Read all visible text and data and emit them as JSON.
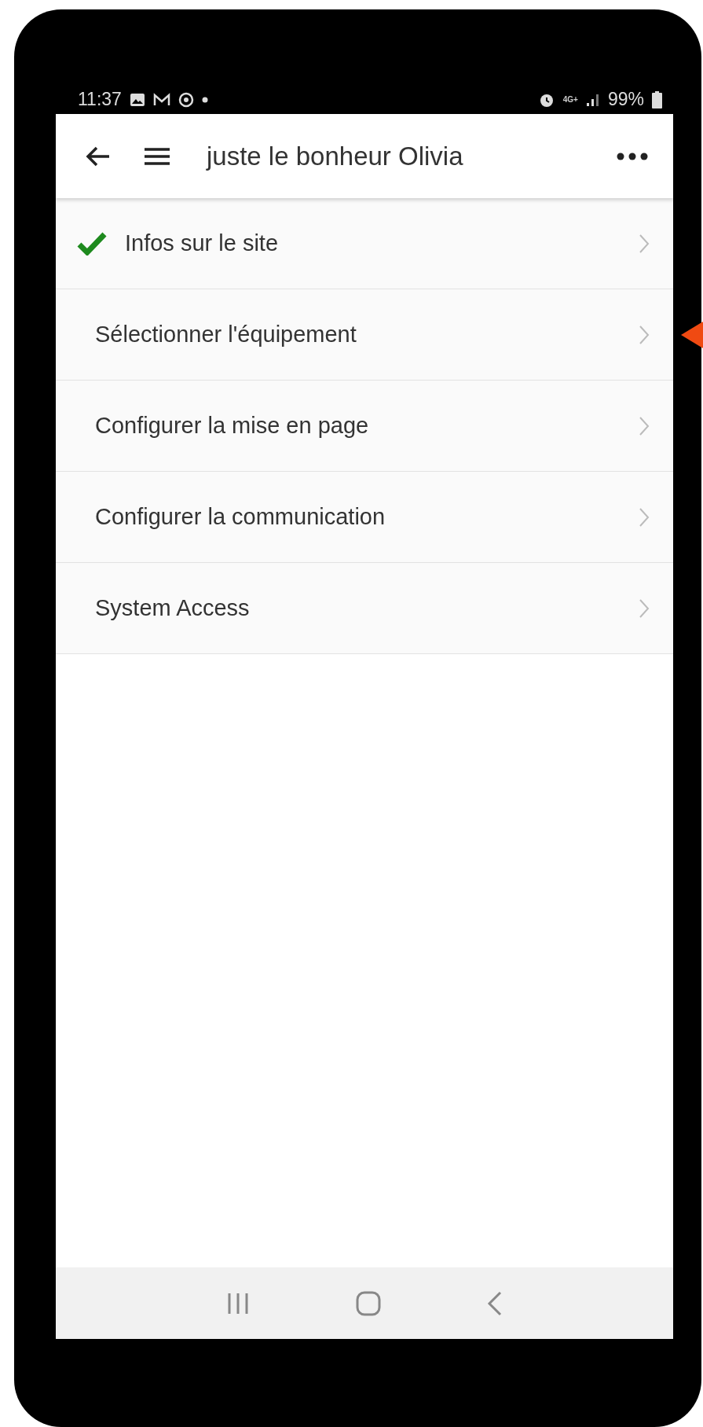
{
  "status_bar": {
    "time": "11:37",
    "network": "4G+",
    "battery": "99%"
  },
  "app_bar": {
    "title": "juste le bonheur Olivia"
  },
  "menu_items": [
    {
      "label": "Infos sur le site",
      "checked": true,
      "pointed": false
    },
    {
      "label": "Sélectionner l'équipement",
      "checked": false,
      "pointed": true
    },
    {
      "label": "Configurer la mise en page",
      "checked": false,
      "pointed": false
    },
    {
      "label": "Configurer la communication",
      "checked": false,
      "pointed": false
    },
    {
      "label": "System Access",
      "checked": false,
      "pointed": false
    }
  ]
}
